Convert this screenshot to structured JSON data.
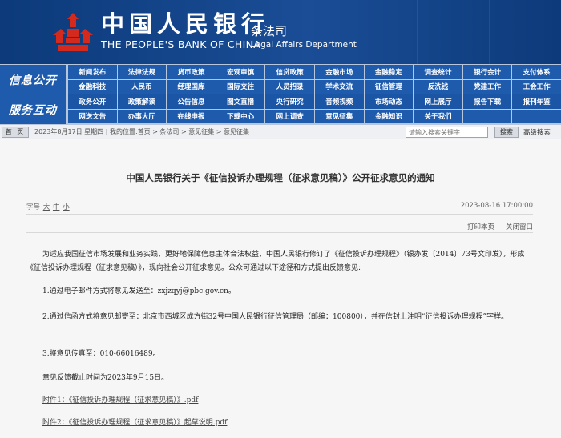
{
  "banner": {
    "bank_cn": "中国人民银行",
    "bank_en": "THE PEOPLE'S BANK OF CHINA",
    "dept_cn": "条法司",
    "dept_en": "Legal Affairs Department",
    "logo_icon": "pboc-logo-icon"
  },
  "nav": {
    "side1": "信息公开",
    "side2": "服务互动",
    "items": [
      "新闻发布",
      "法律法规",
      "货币政策",
      "宏观审慎",
      "信贷政策",
      "金融市场",
      "金融稳定",
      "调查统计",
      "银行会计",
      "支付体系",
      "金融科技",
      "人民币",
      "经理国库",
      "国际交往",
      "人员招录",
      "学术交流",
      "征信管理",
      "反洗钱",
      "党建工作",
      "工会工作",
      "政务公开",
      "政策解读",
      "公告信息",
      "图文直播",
      "央行研究",
      "音频视频",
      "市场动态",
      "网上展厅",
      "报告下载",
      "报刊年鉴",
      "网送文告",
      "办事大厅",
      "在线申报",
      "下载中心",
      "网上调查",
      "意见征集",
      "金融知识",
      "关于我们",
      "",
      ""
    ]
  },
  "locbar": {
    "home": "首 页",
    "location": "2023年8月17日 星期四 | 我的位置:首页 > 条法司 > 意见征集 > 意见征集",
    "search_placeholder": "请输入搜索关键字",
    "search_button": "搜索",
    "advanced": "高级搜索"
  },
  "article": {
    "title": "中国人民银行关于《征信投诉办理规程（征求意见稿）》公开征求意见的通知",
    "font_label": "字号",
    "font_sizes": [
      "大",
      "中",
      "小"
    ],
    "date": "2023-08-16 17:00:00",
    "print": "打印本页",
    "close": "关闭窗口",
    "paragraphs": [
      "为适应我国征信市场发展和业务实践，更好地保障信息主体合法权益，中国人民银行修订了《征信投诉办理规程》（银办发〔2014〕73号文印发），形成《征信投诉办理规程（征求意见稿）》，现向社会公开征求意见。公众可通过以下途径和方式提出反馈意见:",
      "1.通过电子邮件方式将意见发送至：zxjzqyj@pbc.gov.cn。",
      "2.通过信函方式将意见邮寄至：北京市西城区成方街32号中国人民银行征信管理局（邮编：100800），并在信封上注明“征信投诉办理规程”字样。",
      "3.将意见传真至：010-66016489。",
      "意见反馈截止时间为2023年9月15日。"
    ],
    "attachments": [
      "附件1：《征信投诉办理规程（征求意见稿）》.pdf",
      "附件2：《征信投诉办理规程（征求意见稿）》起草说明.pdf"
    ]
  },
  "colors": {
    "banner": "#1a4d96",
    "nav_cell": "#1e5bad",
    "nav_bg": "#b7c6da",
    "logo_red": "#d42a1e"
  }
}
